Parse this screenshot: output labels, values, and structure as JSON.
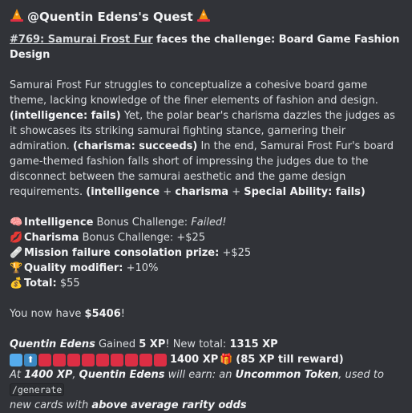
{
  "header": {
    "title": "@Quentin Edens's Quest",
    "icon": "wizard-hat-icon"
  },
  "challenge": {
    "number_link": "#769: Samurai Frost Fur",
    "suffix": " faces the challenge: Board Game Fashion Design"
  },
  "story": {
    "p1": "Samurai Frost Fur struggles to conceptualize a cohesive board game theme, lacking knowledge of the finer elements of fashion and design. ",
    "tag1": "(intelligence: fails)",
    "p2": " Yet, the polar bear's charisma dazzles the judges as it showcases its striking samurai fighting stance, garnering their admiration. ",
    "tag2": "(charisma: succeeds)",
    "p3": " In the end, Samurai Frost Fur's board game-themed fashion falls short of impressing the judges due to the disconnect between the samurai aesthetic and the game design requirements. ",
    "tag3a": "(intelligence",
    "plus1": " + ",
    "tag3b": "charisma",
    "plus2": " + ",
    "tag3c": "Special Ability",
    "tag3d": ": fails)"
  },
  "results": {
    "intel_label": "Intelligence",
    "intel_text": " Bonus Challenge: ",
    "intel_value": "Failed!",
    "char_label": "Charisma",
    "char_text": " Bonus Challenge: +$25",
    "mission_label": "Mission failure consolation prize:",
    "mission_value": " +$25",
    "quality_label": "Quality modifier:",
    "quality_value": " +10%",
    "total_label": "Total:",
    "total_value": " $55"
  },
  "balance": {
    "prefix": "You now have ",
    "amount": "$5406",
    "suffix": "!"
  },
  "xp": {
    "user": "Quentin Edens",
    "gained_text": " Gained ",
    "gained": "5 XP",
    "new_total_text": "! New total: ",
    "new_total": "1315 XP",
    "target": "1400 XP",
    "till_reward": "(85 XP till reward)",
    "progress_fraction": 0.94
  },
  "reward": {
    "at": "At ",
    "xp": "1400 XP",
    "comma": ", ",
    "user": "Quentin Edens",
    "will_earn": " will earn: an ",
    "token": "Uncommon Token",
    "used_to": ", used to ",
    "command": "/generate",
    "new_cards": " new cards with ",
    "odds": "above average rarity odds"
  },
  "colors": {
    "background": "#313338",
    "text": "#dbdee1",
    "bar_blue": "#55acee",
    "bar_red": "#dd2e44"
  }
}
